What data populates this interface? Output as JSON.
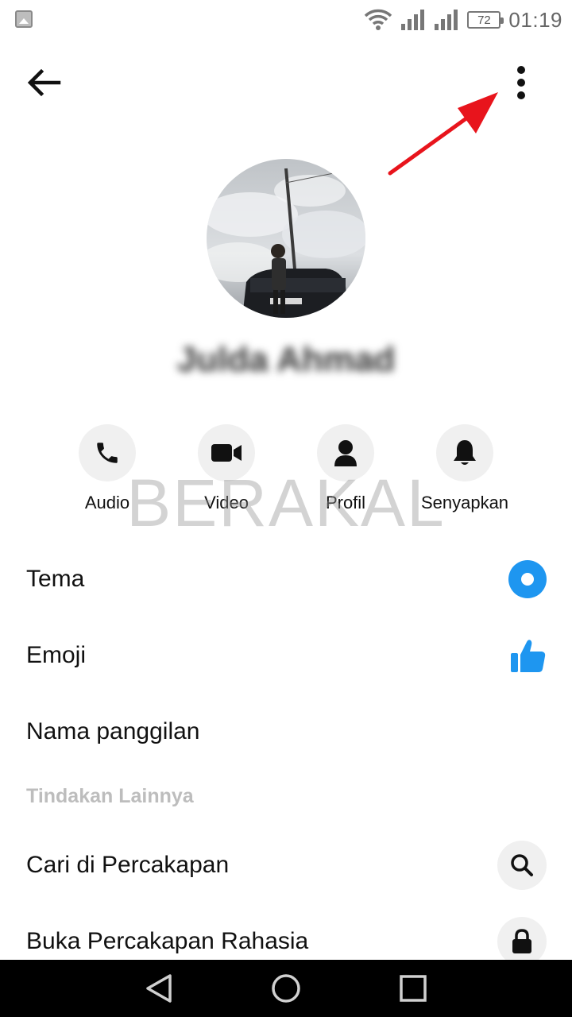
{
  "status_bar": {
    "battery": "72",
    "time": "01:19"
  },
  "contact": {
    "name": "Julda Ahmad"
  },
  "actions": [
    {
      "label": "Audio",
      "icon": "phone-icon"
    },
    {
      "label": "Video",
      "icon": "video-icon"
    },
    {
      "label": "Profil",
      "icon": "person-icon"
    },
    {
      "label": "Senyapkan",
      "icon": "bell-icon"
    }
  ],
  "watermark": "BERAKAL",
  "settings": {
    "tema": "Tema",
    "emoji": "Emoji",
    "nickname": "Nama panggilan"
  },
  "other_actions": {
    "header": "Tindakan Lainnya",
    "search": "Cari di Percakapan",
    "secret": "Buka Percakapan Rahasia"
  },
  "colors": {
    "accent": "#1e96f0",
    "annotation": "#e8141c"
  }
}
